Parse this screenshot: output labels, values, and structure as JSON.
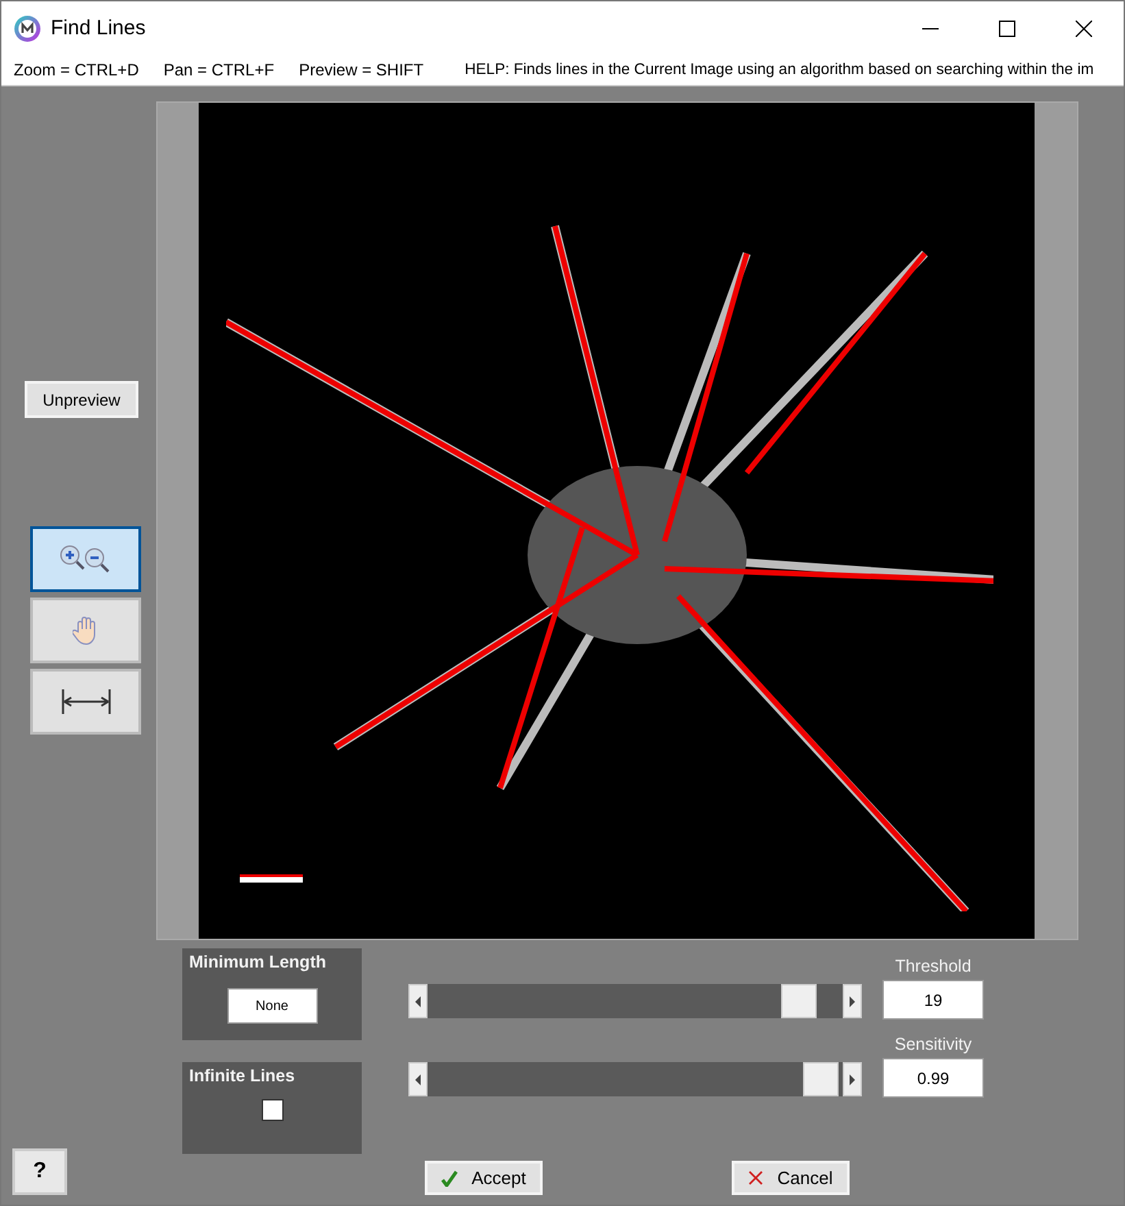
{
  "window": {
    "title": "Find Lines"
  },
  "shortcuts": [
    "Zoom = CTRL+D",
    "Pan = CTRL+F",
    "Preview = SHIFT"
  ],
  "help": "HELP:  Finds lines in the Current Image using an algorithm based on searching within the im",
  "unpreview_button": "Unpreview",
  "tools": [
    {
      "kind": "zoom",
      "selected": true
    },
    {
      "kind": "pan",
      "selected": false
    },
    {
      "kind": "measure",
      "selected": false
    }
  ],
  "minimum_length": {
    "label": "Minimum Length",
    "value": "None"
  },
  "infinite_lines": {
    "label": "Infinite Lines",
    "checked": false
  },
  "sliders": [
    {
      "label": "Threshold",
      "level": 0.93,
      "value": "19"
    },
    {
      "label": "Sensitivity",
      "level": 0.99,
      "value": "0.99"
    }
  ],
  "buttons": [
    {
      "kind": "accept",
      "label": "Accept"
    },
    {
      "kind": "cancel",
      "label": "Cancel"
    }
  ],
  "help_button": "?"
}
